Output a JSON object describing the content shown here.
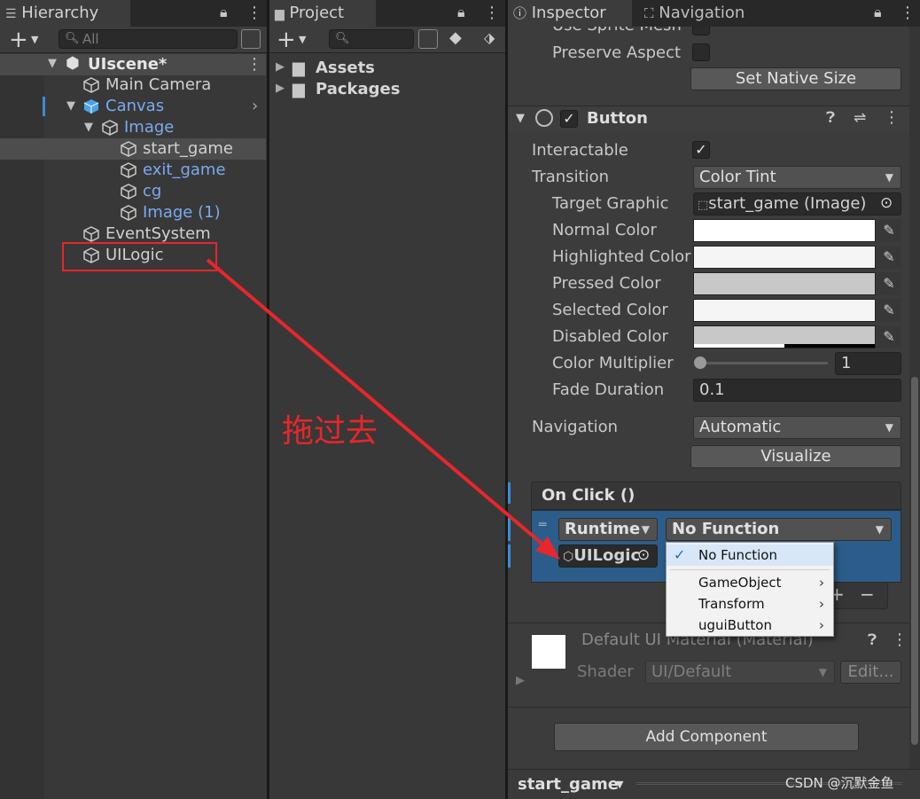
{
  "hierarchy": {
    "tab_label": "Hierarchy",
    "search_placeholder": "All",
    "scene_name": "UIscene*",
    "items": [
      {
        "label": "Main Camera"
      },
      {
        "label": "Canvas"
      },
      {
        "label": "Image"
      },
      {
        "label": "start_game"
      },
      {
        "label": "exit_game"
      },
      {
        "label": "cg"
      },
      {
        "label": "Image (1)"
      },
      {
        "label": "EventSystem"
      },
      {
        "label": "UILogic"
      }
    ]
  },
  "project": {
    "tab_label": "Project",
    "folders": [
      {
        "label": "Assets"
      },
      {
        "label": "Packages"
      }
    ]
  },
  "inspector": {
    "tab_label": "Inspector",
    "nav_tab_label": "Navigation",
    "use_sprite_mesh_label": "Use Sprite Mesh",
    "preserve_aspect_label": "Preserve Aspect",
    "set_native_size_label": "Set Native Size",
    "button_component_title": "Button",
    "interactable_label": "Interactable",
    "transition_label": "Transition",
    "transition_value": "Color Tint",
    "target_graphic_label": "Target Graphic",
    "target_graphic_value": "start_game (Image)",
    "colors": [
      {
        "label": "Normal Color",
        "value": "#ffffff"
      },
      {
        "label": "Highlighted Color",
        "value": "#f5f5f5"
      },
      {
        "label": "Pressed Color",
        "value": "#c8c8c8"
      },
      {
        "label": "Selected Color",
        "value": "#f5f5f5"
      },
      {
        "label": "Disabled Color",
        "value": "#c8c8c8"
      }
    ],
    "color_multiplier_label": "Color Multiplier",
    "color_multiplier_value": "1",
    "fade_duration_label": "Fade Duration",
    "fade_duration_value": "0.1",
    "navigation_label": "Navigation",
    "navigation_value": "Automatic",
    "visualize_label": "Visualize",
    "on_click_title": "On Click ()",
    "runtime_value": "Runtime",
    "function_value": "No Function",
    "object_value": "UILogic",
    "material_title": "Default UI Material (Material)",
    "shader_label": "Shader",
    "shader_value": "UI/Default",
    "edit_label": "Edit...",
    "add_component_label": "Add Component",
    "footer_object": "start_game",
    "minus_label": "−",
    "plus_label": "+"
  },
  "function_menu": {
    "items": [
      {
        "label": "No Function",
        "checked": true
      },
      {
        "label": "GameObject",
        "submenu": true
      },
      {
        "label": "Transform",
        "submenu": true
      },
      {
        "label": "uguiButton",
        "submenu": true
      }
    ]
  },
  "annotation": {
    "text": "拖过去",
    "color": "#e8262b"
  },
  "watermark": "CSDN @沉默金鱼"
}
